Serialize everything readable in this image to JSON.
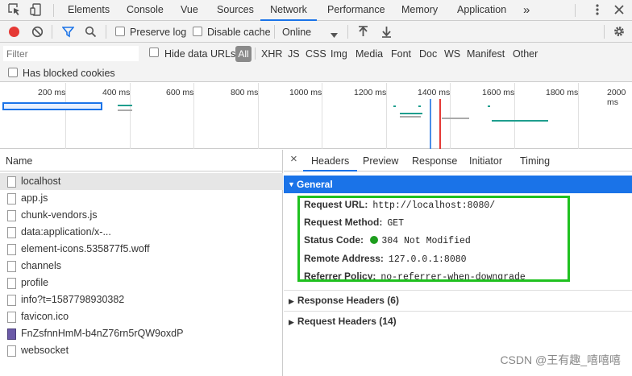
{
  "tabs": [
    "Elements",
    "Console",
    "Vue",
    "Sources",
    "Network",
    "Performance",
    "Memory",
    "Application"
  ],
  "more_label": "»",
  "toolbar": {
    "preserve_log": "Preserve log",
    "disable_cache": "Disable cache",
    "throttle": "Online"
  },
  "filter": {
    "placeholder": "Filter",
    "hide_data_urls": "Hide data URLs",
    "all": "All",
    "types": [
      "XHR",
      "JS",
      "CSS",
      "Img",
      "Media",
      "Font",
      "Doc",
      "WS",
      "Manifest",
      "Other"
    ],
    "has_blocked_cookies": "Has blocked cookies"
  },
  "overview": {
    "ticks": [
      "200 ms",
      "400 ms",
      "600 ms",
      "800 ms",
      "1000 ms",
      "1200 ms",
      "1400 ms",
      "1600 ms",
      "1800 ms",
      "2000 ms"
    ]
  },
  "requests": {
    "header": "Name",
    "items": [
      "localhost",
      "app.js",
      "chunk-vendors.js",
      "data:application/x-...",
      "element-icons.535877f5.woff",
      "channels",
      "profile",
      "info?t=1587798930382",
      "favicon.ico",
      "FnZsfnnHmM-b4nZ76rn5rQW9oxdP",
      "websocket"
    ]
  },
  "details": {
    "close": "×",
    "tabs": [
      "Headers",
      "Preview",
      "Response",
      "Initiator",
      "Timing"
    ],
    "general_title": "General",
    "general": [
      {
        "key": "Request URL:",
        "value": "http://localhost:8080/"
      },
      {
        "key": "Request Method:",
        "value": "GET"
      },
      {
        "key": "Status Code:",
        "value": "304 Not Modified"
      },
      {
        "key": "Remote Address:",
        "value": "127.0.0.1:8080"
      },
      {
        "key": "Referrer Policy:",
        "value": "no-referrer-when-downgrade"
      }
    ],
    "response_headers": "Response Headers (6)",
    "request_headers": "Request Headers (14)"
  },
  "watermark": "CSDN @王有趣_嘻嘻嘻",
  "colors": {
    "accent": "#1a73e8",
    "record": "#e53935",
    "status_ok": "#1e9e1e",
    "highlight": "#1fc11f"
  }
}
